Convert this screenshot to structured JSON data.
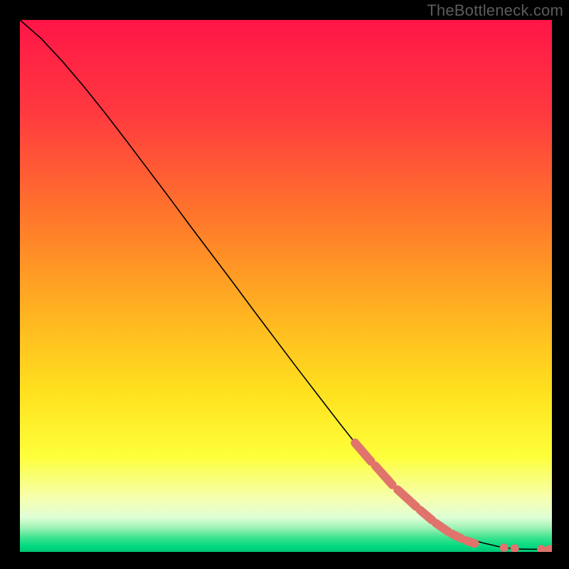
{
  "watermark": "TheBottleneck.com",
  "chart_data": {
    "type": "line",
    "title": "",
    "xlabel": "",
    "ylabel": "",
    "xlim": [
      0,
      100
    ],
    "ylim": [
      0,
      100
    ],
    "grid": false,
    "series": [
      {
        "name": "curve",
        "color": "#000000",
        "x": [
          0,
          4,
          8,
          12,
          16,
          20,
          24,
          28,
          32,
          36,
          40,
          44,
          48,
          52,
          56,
          60,
          63,
          66,
          69,
          72,
          75,
          78,
          81,
          84,
          87,
          90,
          92,
          94,
          96,
          98,
          100
        ],
        "y": [
          100,
          96.5,
          92.2,
          87.5,
          82.5,
          77.3,
          72.0,
          66.7,
          61.3,
          56.0,
          50.7,
          45.3,
          40.0,
          34.7,
          29.5,
          24.3,
          20.5,
          17.0,
          13.8,
          10.8,
          8.1,
          5.8,
          4.0,
          2.6,
          1.7,
          1.0,
          0.7,
          0.55,
          0.5,
          0.5,
          0.5
        ]
      }
    ],
    "highlight_points": {
      "name": "markers",
      "color": "#e0736c",
      "radius": 6,
      "segments": [
        {
          "x_start": 63,
          "x_end": 66,
          "y_start": 20.5,
          "y_end": 17.0
        },
        {
          "x_start": 66.8,
          "x_end": 70,
          "y_start": 16.2,
          "y_end": 12.6
        },
        {
          "x_start": 71,
          "x_end": 74.5,
          "y_start": 11.7,
          "y_end": 8.5
        },
        {
          "x_start": 75.2,
          "x_end": 77.5,
          "y_start": 7.9,
          "y_end": 5.95
        },
        {
          "x_start": 78.2,
          "x_end": 80.5,
          "y_start": 5.4,
          "y_end": 3.8
        },
        {
          "x_start": 81.2,
          "x_end": 83,
          "y_start": 3.4,
          "y_end": 2.5
        },
        {
          "x_start": 84,
          "x_end": 85.5,
          "y_start": 2.1,
          "y_end": 1.6
        }
      ],
      "isolated": [
        {
          "x": 91,
          "y": 0.8
        },
        {
          "x": 93,
          "y": 0.65
        },
        {
          "x": 98,
          "y": 0.52
        },
        {
          "x": 99.5,
          "y": 0.5
        }
      ]
    },
    "gradient_bands": [
      {
        "stop": 0.0,
        "color": "#ff1547"
      },
      {
        "stop": 0.18,
        "color": "#ff3b3f"
      },
      {
        "stop": 0.38,
        "color": "#ff7a2a"
      },
      {
        "stop": 0.55,
        "color": "#ffb321"
      },
      {
        "stop": 0.7,
        "color": "#ffe11e"
      },
      {
        "stop": 0.82,
        "color": "#feff3a"
      },
      {
        "stop": 0.9,
        "color": "#f6ffb0"
      },
      {
        "stop": 0.935,
        "color": "#dfffd6"
      },
      {
        "stop": 0.955,
        "color": "#9cf2b4"
      },
      {
        "stop": 0.975,
        "color": "#34e28c"
      },
      {
        "stop": 0.99,
        "color": "#00d980"
      },
      {
        "stop": 1.0,
        "color": "#00c574"
      }
    ]
  }
}
